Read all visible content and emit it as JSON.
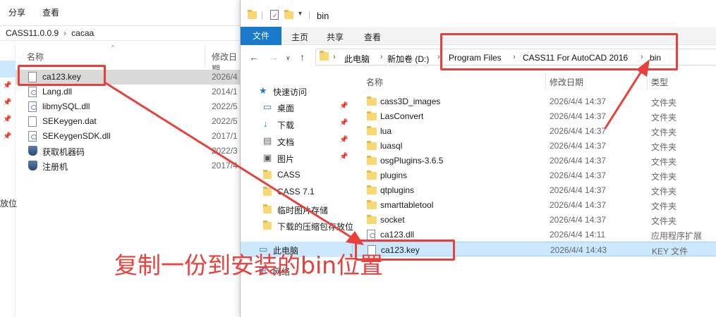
{
  "left_window": {
    "menu": [
      "分享",
      "查看"
    ],
    "breadcrumb": [
      "CASS11.0.0.9",
      "cacaa"
    ],
    "col_name": "名称",
    "col_date": "修改日期",
    "nav_text": "放位",
    "files": [
      {
        "name": "ca123.key",
        "date": "2026/4",
        "icon": "doc-icon",
        "selected": true
      },
      {
        "name": "Lang.dll",
        "date": "2014/1",
        "icon": "dll-icon"
      },
      {
        "name": "libmySQL.dll",
        "date": "2022/5",
        "icon": "dll-icon"
      },
      {
        "name": "SEKeygen.dat",
        "date": "2022/5",
        "icon": "doc-icon"
      },
      {
        "name": "SEKeygenSDK.dll",
        "date": "2017/1",
        "icon": "dll-icon"
      },
      {
        "name": "获取机器码",
        "date": "2022/3",
        "icon": "shield-icon"
      },
      {
        "name": "注册机",
        "date": "2017/4",
        "icon": "shield-icon"
      }
    ]
  },
  "right_window": {
    "title": "bin",
    "ribbon_tabs": [
      "文件",
      "主页",
      "共享",
      "查看"
    ],
    "breadcrumb": [
      "此电脑",
      "新加卷 (D:)",
      "Program Files",
      "CASS11 For AutoCAD 2016",
      "bin"
    ],
    "nav_items": [
      {
        "label": "快速访问",
        "icon": "star-icon",
        "indent": 0
      },
      {
        "label": "桌面",
        "icon": "desktop-icon",
        "indent": 1,
        "pin": true
      },
      {
        "label": "下载",
        "icon": "download-icon",
        "indent": 1,
        "pin": true
      },
      {
        "label": "文档",
        "icon": "document-icon",
        "indent": 1,
        "pin": true
      },
      {
        "label": "图片",
        "icon": "picture-icon",
        "indent": 1,
        "pin": true
      },
      {
        "label": "CASS",
        "icon": "folder-icon",
        "indent": 1
      },
      {
        "label": "CASS 7.1",
        "icon": "folder-icon",
        "indent": 1
      },
      {
        "label": "临时图片存储",
        "icon": "folder-icon",
        "indent": 1
      },
      {
        "label": "下载的压缩包存放位",
        "icon": "folder-icon",
        "indent": 1
      },
      {
        "label": "此电脑",
        "icon": "computer-icon",
        "indent": 0,
        "selected": true
      },
      {
        "label": "网络",
        "icon": "network-icon",
        "indent": 0
      }
    ],
    "columns": {
      "name": "名称",
      "date": "修改日期",
      "type": "类型"
    },
    "files": [
      {
        "name": "cass3D_images",
        "date": "2026/4/4 14:37",
        "type": "文件夹",
        "icon": "folder-icon"
      },
      {
        "name": "LasConvert",
        "date": "2026/4/4 14:37",
        "type": "文件夹",
        "icon": "folder-icon"
      },
      {
        "name": "lua",
        "date": "2026/4/4 14:37",
        "type": "文件夹",
        "icon": "folder-icon"
      },
      {
        "name": "luasql",
        "date": "2026/4/4 14:37",
        "type": "文件夹",
        "icon": "folder-icon"
      },
      {
        "name": "osgPlugins-3.6.5",
        "date": "2026/4/4 14:37",
        "type": "文件夹",
        "icon": "folder-icon"
      },
      {
        "name": "plugins",
        "date": "2026/4/4 14:37",
        "type": "文件夹",
        "icon": "folder-icon"
      },
      {
        "name": "qtplugins",
        "date": "2026/4/4 14:37",
        "type": "文件夹",
        "icon": "folder-icon"
      },
      {
        "name": "smarttabletool",
        "date": "2026/4/4 14:37",
        "type": "文件夹",
        "icon": "folder-icon"
      },
      {
        "name": "socket",
        "date": "2026/4/4 14:37",
        "type": "文件夹",
        "icon": "folder-icon"
      },
      {
        "name": "ca123.dll",
        "date": "2026/4/4 14:11",
        "type": "应用程序扩展",
        "icon": "dll-icon"
      },
      {
        "name": "ca123.key",
        "date": "2026/4/4 14:43",
        "type": "KEY 文件",
        "icon": "doc-icon",
        "selected": true
      }
    ]
  },
  "annotation": {
    "text": "复制一份到安装的bin位置",
    "color": "#e8413c"
  }
}
